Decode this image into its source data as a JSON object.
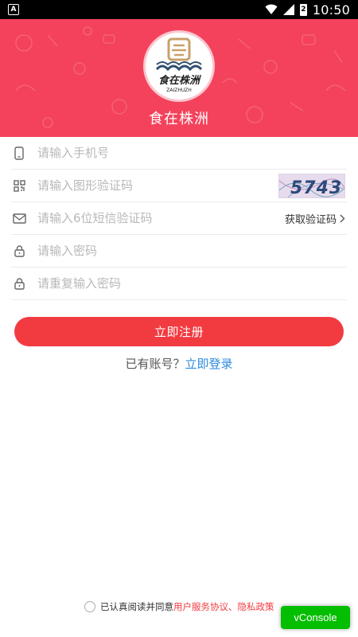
{
  "status_bar": {
    "time": "10:50",
    "battery_level": "2"
  },
  "header": {
    "app_title": "食在株洲",
    "logo_text": "食在株洲",
    "logo_subtext": "ZAIZHUZH"
  },
  "form": {
    "phone": {
      "placeholder": "请输入手机号",
      "icon": "phone-icon"
    },
    "image_code": {
      "placeholder": "请输入图形验证码",
      "icon": "qr-icon",
      "captcha_text": "5743"
    },
    "sms_code": {
      "placeholder": "请输入6位短信验证码",
      "icon": "mail-icon",
      "get_code_label": "获取验证码"
    },
    "password": {
      "placeholder": "请输入密码",
      "icon": "lock-icon"
    },
    "confirm_password": {
      "placeholder": "请重复输入密码",
      "icon": "lock-icon"
    }
  },
  "register_button": "立即注册",
  "login_prompt": {
    "text": "已有账号？",
    "link": "立即登录"
  },
  "agreement": {
    "prefix": "已认真阅读并同意",
    "user_agreement": "用户服务协议",
    "separator": "、",
    "privacy_policy": "隐私政策"
  },
  "vconsole_label": "vConsole",
  "colors": {
    "brand_red": "#f4425c",
    "button_red": "#f23b41",
    "link_blue": "#2d8ae0",
    "vconsole_green": "#04be02"
  }
}
